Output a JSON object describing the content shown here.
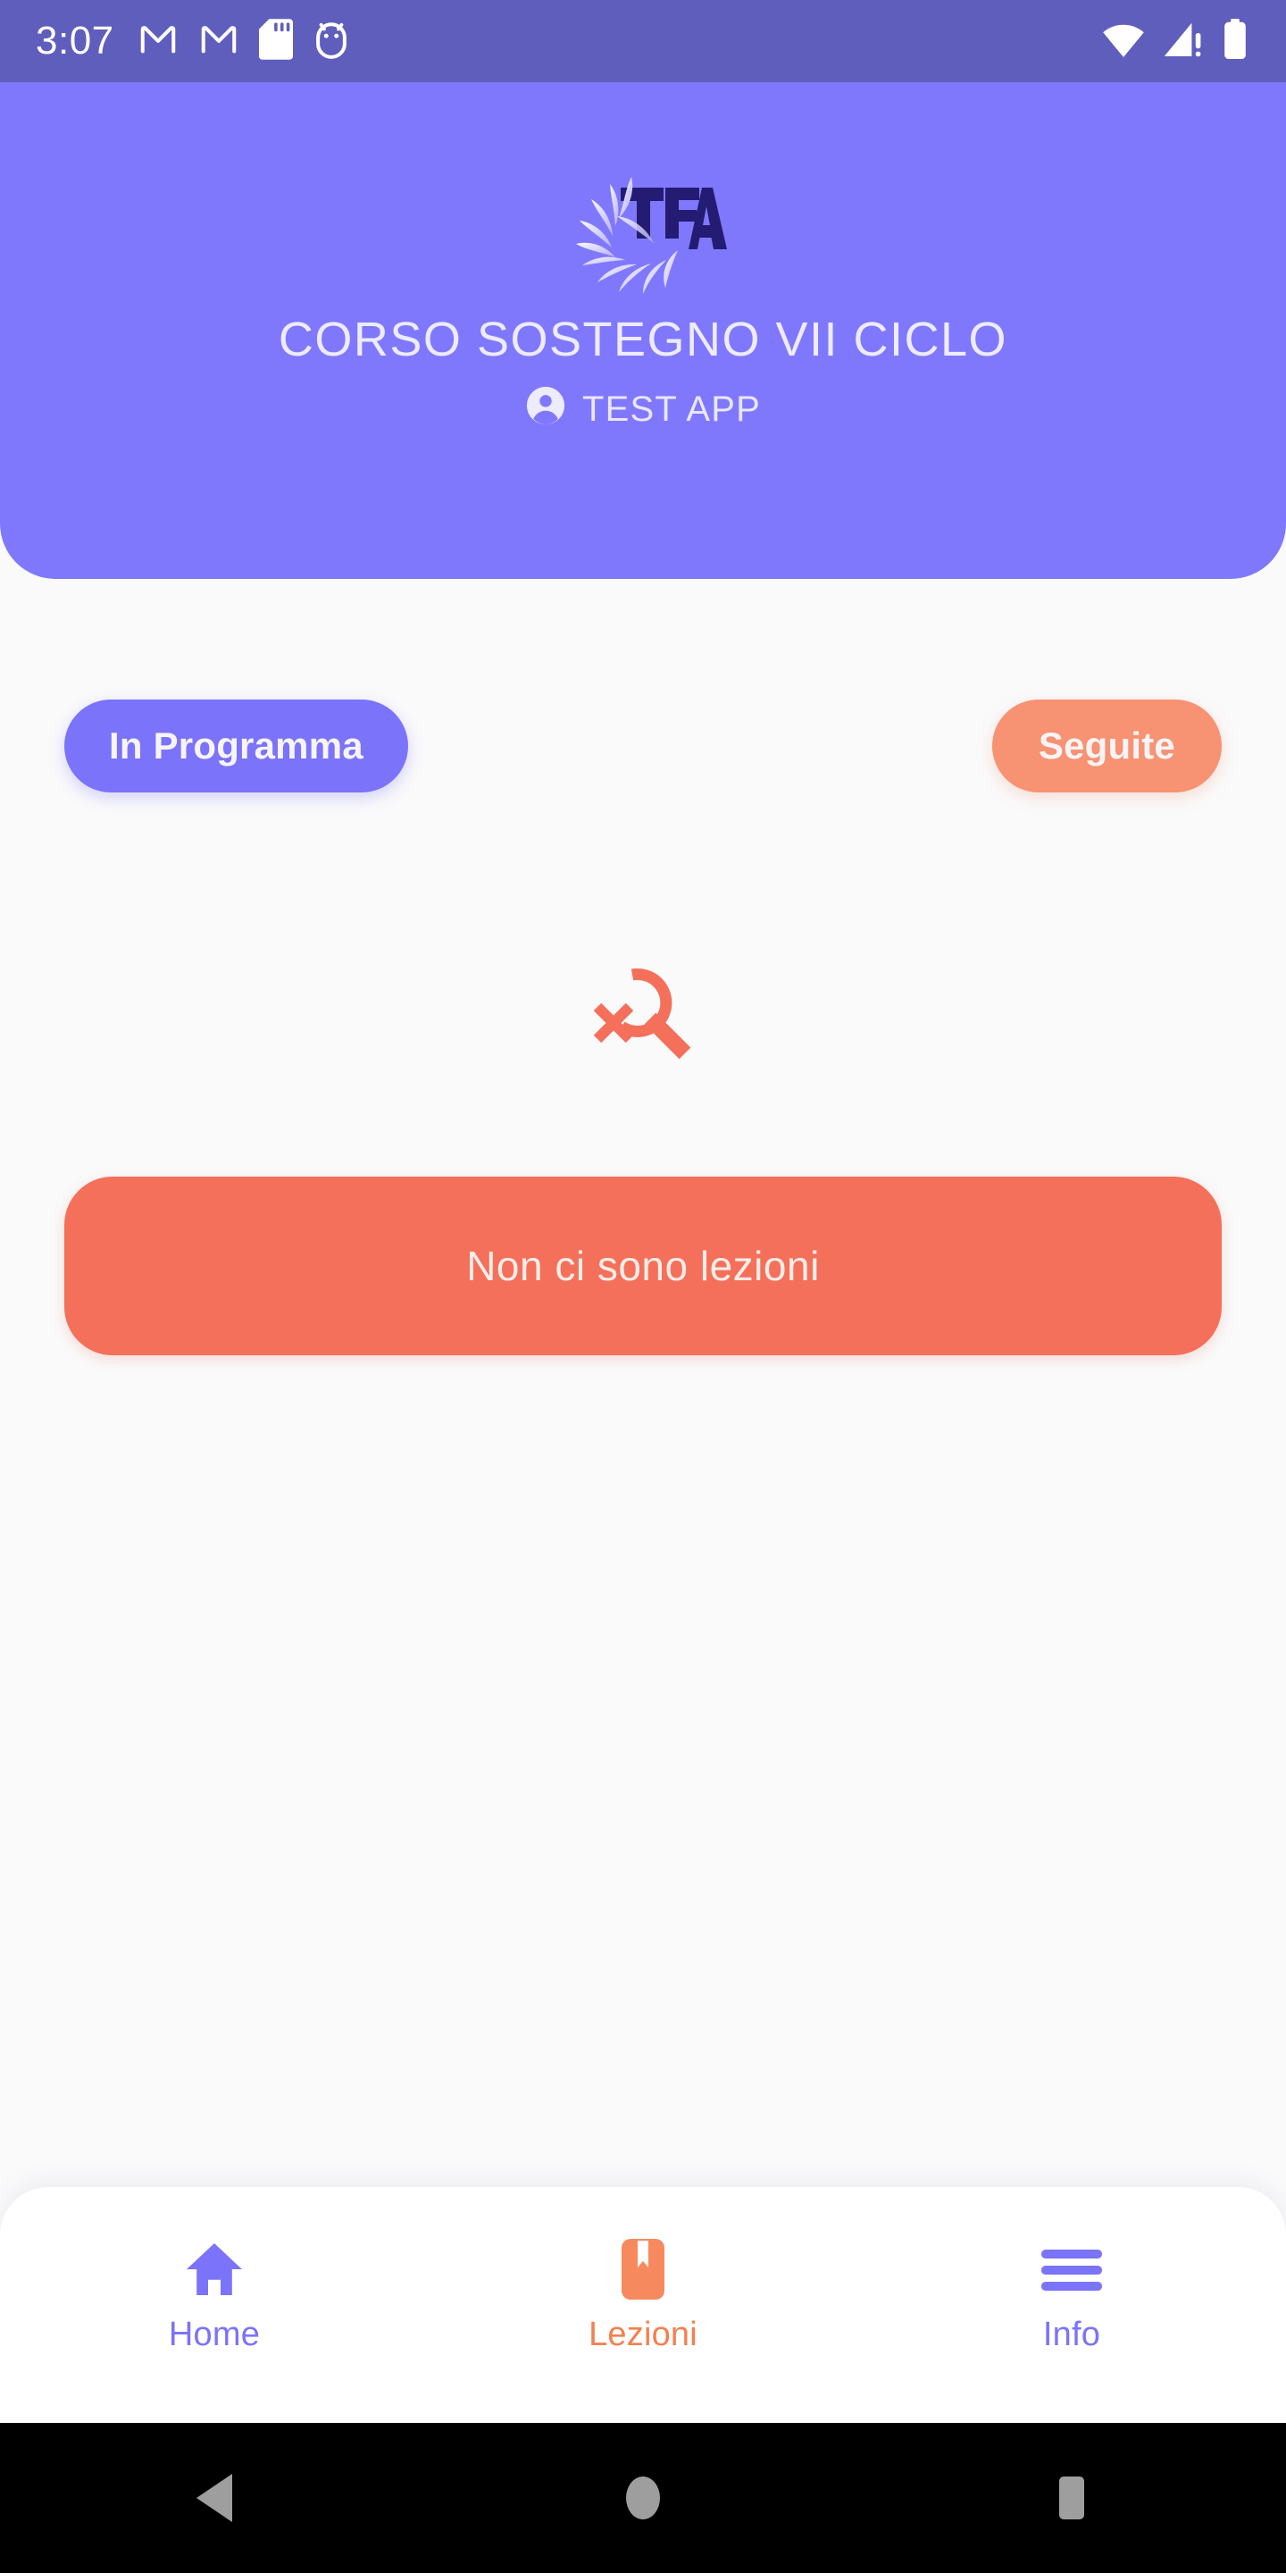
{
  "status_bar": {
    "clock": "3:07",
    "left_icons": [
      "gmail-icon",
      "gmail-icon",
      "sd-card-icon",
      "android-droid-icon"
    ],
    "right_icons": [
      "wifi-icon",
      "cellular-signal-alert-icon",
      "battery-icon"
    ],
    "background_color": "#605EBC"
  },
  "header": {
    "logo_text": "TFA",
    "logo_name": "tfa-sunburst-logo",
    "title": "CORSO SOSTEGNO VII CICLO",
    "account_icon": "account-circle-icon",
    "account_name": "TEST APP",
    "background_color": "#8078FC"
  },
  "filters": {
    "scheduled_label": "In Programma",
    "scheduled_active": true,
    "scheduled_color": "#7B73F9",
    "followed_label": "Seguite",
    "followed_active": false,
    "followed_color": "#F79272"
  },
  "empty_state": {
    "icon": "search-no-results-icon",
    "icon_color": "#F4705A",
    "message": "Non ci sono lezioni",
    "banner_color": "#F4705A"
  },
  "bottom_nav": {
    "items": [
      {
        "label": "Home",
        "icon": "home-icon",
        "active": false,
        "color": "#7B73F9"
      },
      {
        "label": "Lezioni",
        "icon": "bookmark-book-icon",
        "active": true,
        "color": "#F4804F"
      },
      {
        "label": "Info",
        "icon": "menu-hamburger-icon",
        "active": false,
        "color": "#7B73F9"
      }
    ]
  },
  "android_nav": {
    "back": "back-triangle-icon",
    "home": "home-circle-icon",
    "recents": "recents-square-icon",
    "color": "#9E9E9E"
  }
}
